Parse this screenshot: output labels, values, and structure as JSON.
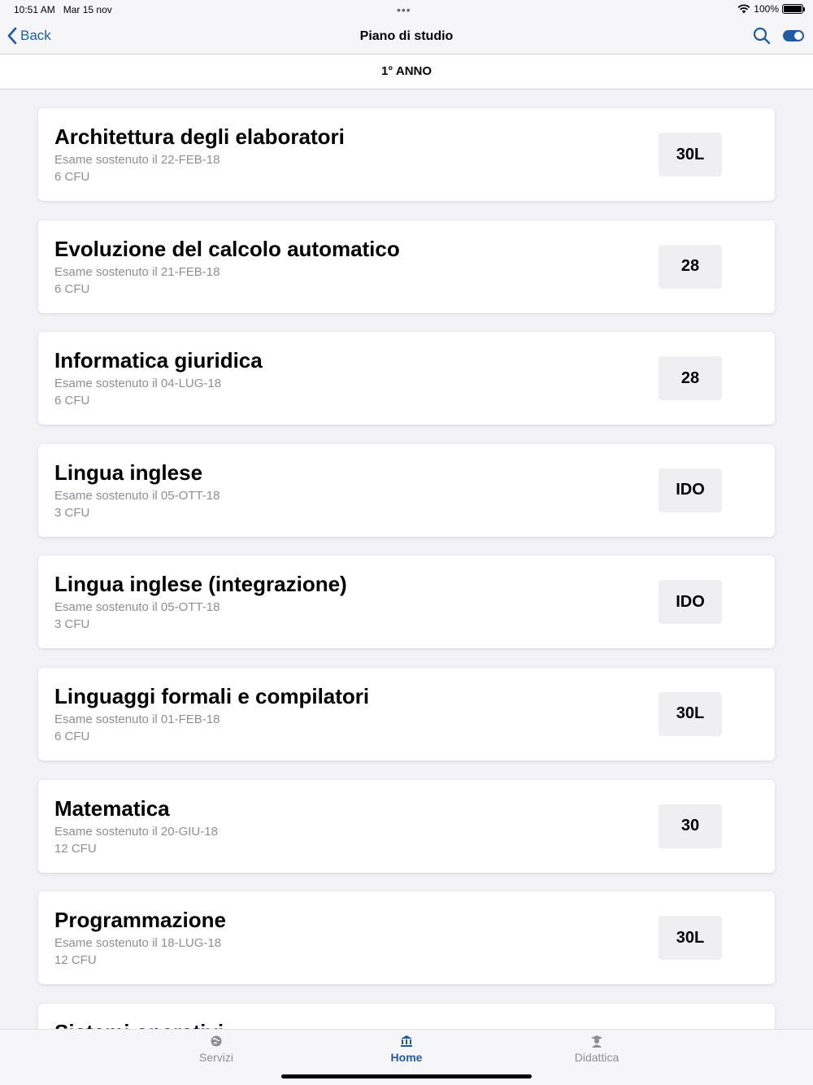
{
  "status": {
    "time": "10:51 AM",
    "date": "Mar 15 nov",
    "battery": "100%"
  },
  "nav": {
    "back_label": "Back",
    "title": "Piano di studio"
  },
  "section": {
    "title": "1° ANNO"
  },
  "courses": [
    {
      "title": "Architettura degli elaboratori",
      "date": "Esame sostenuto il 22-FEB-18",
      "cfu": "6 CFU",
      "grade": "30L"
    },
    {
      "title": "Evoluzione del calcolo automatico",
      "date": "Esame sostenuto il 21-FEB-18",
      "cfu": "6 CFU",
      "grade": "28"
    },
    {
      "title": "Informatica giuridica",
      "date": "Esame sostenuto il 04-LUG-18",
      "cfu": "6 CFU",
      "grade": "28"
    },
    {
      "title": "Lingua inglese",
      "date": "Esame sostenuto il 05-OTT-18",
      "cfu": "3 CFU",
      "grade": "IDO"
    },
    {
      "title": "Lingua inglese (integrazione)",
      "date": "Esame sostenuto il 05-OTT-18",
      "cfu": "3 CFU",
      "grade": "IDO"
    },
    {
      "title": "Linguaggi formali e compilatori",
      "date": "Esame sostenuto il 01-FEB-18",
      "cfu": "6 CFU",
      "grade": "30L"
    },
    {
      "title": "Matematica",
      "date": "Esame sostenuto il 20-GIU-18",
      "cfu": "12 CFU",
      "grade": "30"
    },
    {
      "title": "Programmazione",
      "date": "Esame sostenuto il 18-LUG-18",
      "cfu": "12 CFU",
      "grade": "30L"
    },
    {
      "title": "Sistemi operativi",
      "date": "",
      "cfu": "",
      "grade": ""
    }
  ],
  "tabs": [
    {
      "label": "Servizi",
      "icon": "globe-icon",
      "active": false
    },
    {
      "label": "Home",
      "icon": "university-icon",
      "active": true
    },
    {
      "label": "Didattica",
      "icon": "graduate-icon",
      "active": false
    }
  ],
  "colors": {
    "accent": "#1e5aa8",
    "grade_bg": "#efeff1"
  }
}
